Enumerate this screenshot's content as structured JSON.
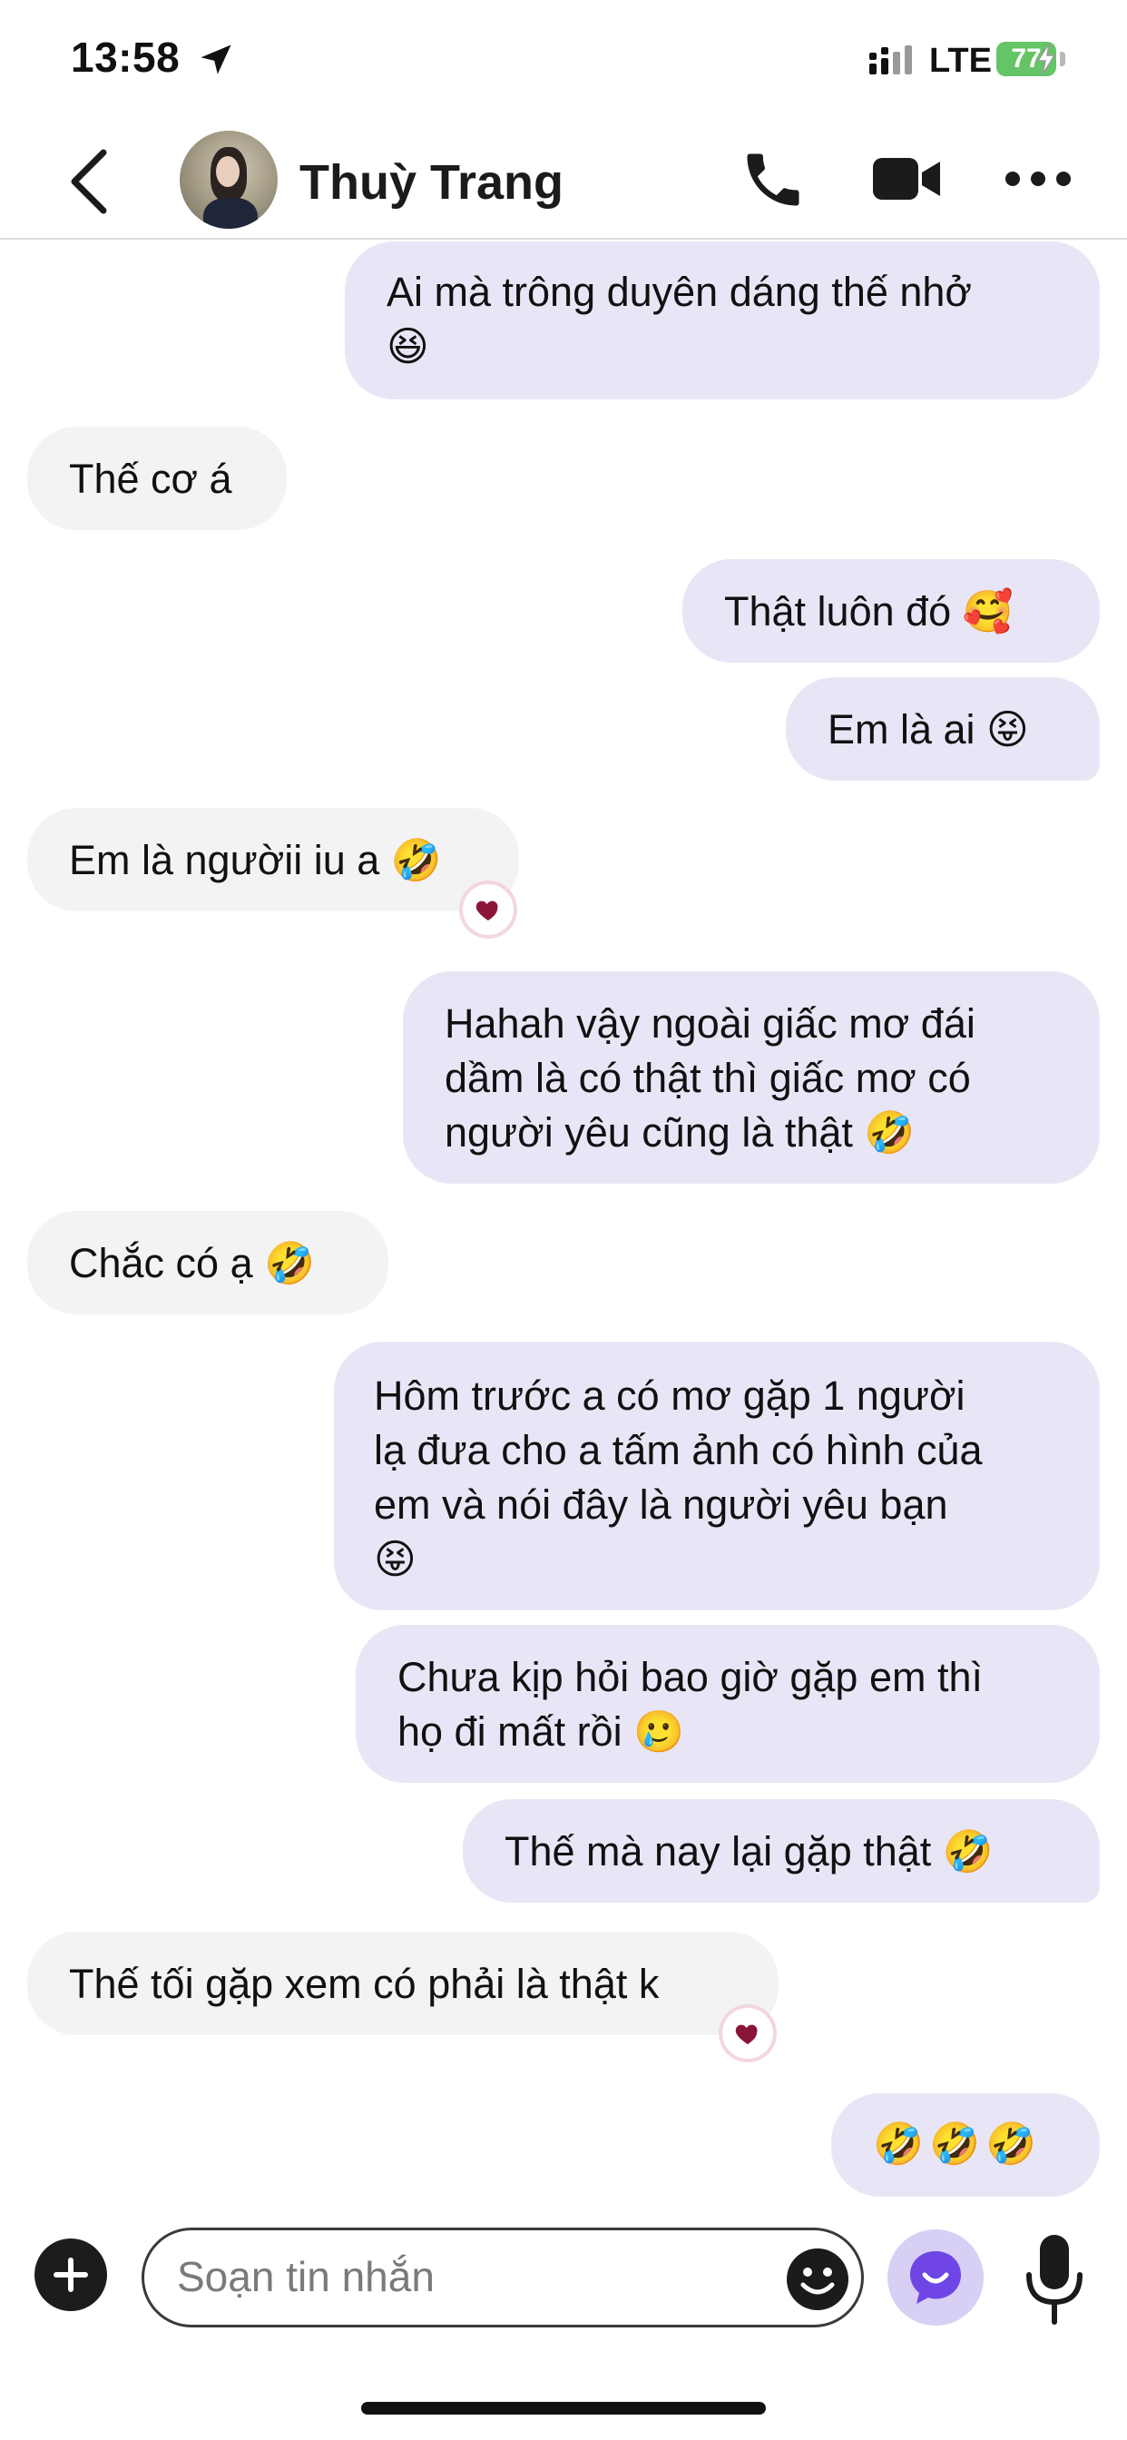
{
  "status_bar": {
    "time": "13:58",
    "network": "LTE",
    "battery": "77"
  },
  "header": {
    "contact_name": "Thuỳ Trang"
  },
  "messages": [
    {
      "direction": "out",
      "text": "Ai mà trông duyên dáng thế nhở\n😆"
    },
    {
      "direction": "in",
      "text": "Thế cơ á"
    },
    {
      "direction": "out",
      "text": "Thật luôn đó 🥰"
    },
    {
      "direction": "out",
      "text": "Em là ai 😝"
    },
    {
      "direction": "in",
      "text": "Em là ngườii iu a 🤣",
      "reaction": "heart"
    },
    {
      "direction": "out",
      "text": "Hahah vậy  ngoài giấc mơ đái\ndầm là có thật thì giấc mơ có\nngười yêu cũng là thật 🤣"
    },
    {
      "direction": "in",
      "text": "Chắc có ạ 🤣"
    },
    {
      "direction": "out",
      "text": "Hôm trước a có mơ gặp 1 người\nlạ đưa cho a tấm ảnh có hình của\nem và nói đây là người yêu bạn\n😝"
    },
    {
      "direction": "out",
      "text": "Chưa kịp hỏi bao giờ gặp em thì\nhọ đi mất rồi 🥲"
    },
    {
      "direction": "out",
      "text": "Thế mà nay lại gặp thật 🤣"
    },
    {
      "direction": "in",
      "text": "Thế tối gặp xem có phải là thật k",
      "reaction": "heart"
    },
    {
      "direction": "out",
      "text": "🤣🤣🤣"
    }
  ],
  "composer": {
    "placeholder": "Soạn tin nhắn"
  },
  "colors": {
    "outgoing_bubble": "#e8e6f6",
    "incoming_bubble": "#f3f3f4",
    "reaction_heart": "#8b1538",
    "battery_green": "#65c466",
    "ai_button": "#d7cff4",
    "ai_icon": "#6f45e6"
  },
  "icons": {
    "back": "chevron-left-icon",
    "call": "phone-icon",
    "video": "video-camera-icon",
    "more": "ellipsis-icon",
    "add": "plus-circle-icon",
    "emoji": "smiley-icon",
    "ai": "ai-chat-icon",
    "mic": "microphone-icon"
  }
}
